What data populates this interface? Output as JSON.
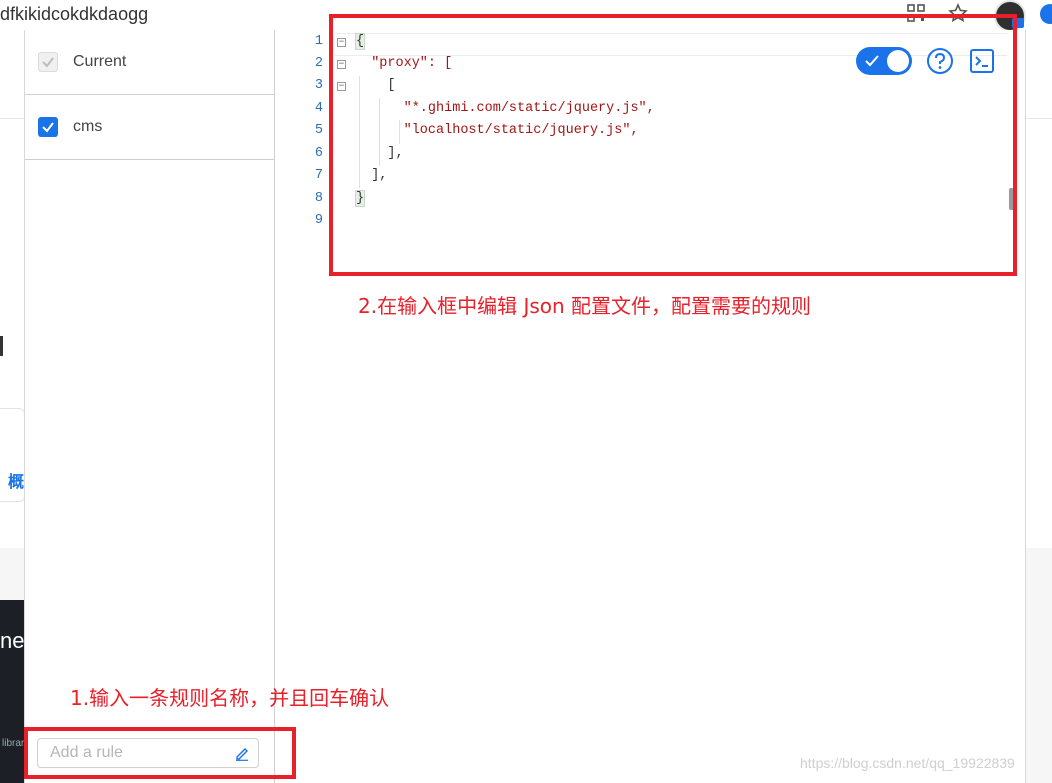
{
  "browser": {
    "url_fragment": "dfkikidcokdkdaogg",
    "icons": [
      "qr-code-icon",
      "star-icon",
      "extension-avatar-icon",
      "extension-blue-icon"
    ]
  },
  "background_page": {
    "card_text": "概",
    "dark_text": "ne",
    "dark_small": "librar"
  },
  "sidebar": {
    "rules": [
      {
        "label": "Current",
        "checked": true,
        "disabled": true
      },
      {
        "label": "cms",
        "checked": true,
        "disabled": false
      }
    ],
    "add_rule": {
      "placeholder": "Add a rule",
      "value": ""
    }
  },
  "editor": {
    "line_numbers": [
      "1",
      "2",
      "3",
      "4",
      "5",
      "6",
      "7",
      "8",
      "9"
    ],
    "lines": [
      "{",
      "  \"proxy\": [",
      "    [",
      "      \"*.ghimi.com/static/jquery.js\",",
      "      \"localhost/static/jquery.js\",",
      "    ],",
      "  ],",
      "}",
      ""
    ],
    "toolbar": {
      "toggle_on": true,
      "icons": [
        "toggle-switch",
        "help-icon",
        "terminal-icon"
      ]
    }
  },
  "annotations": {
    "step1": "1.输入一条规则名称，并且回车确认",
    "step2": "2.在输入框中编辑 Json 配置文件，配置需要的规则",
    "color": "#e8202a"
  },
  "watermark": "https://blog.csdn.net/qq_19922839",
  "colors": {
    "accent": "#1a73e8",
    "annotation": "#e8202a"
  }
}
